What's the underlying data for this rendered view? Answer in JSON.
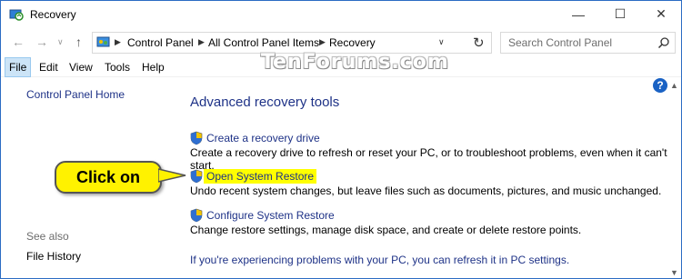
{
  "window": {
    "title": "Recovery",
    "controls": {
      "minimize": "—",
      "maximize": "☐",
      "close": "✕"
    }
  },
  "address_bar": {
    "breadcrumbs": [
      "Control Panel",
      "All Control Panel Items",
      "Recovery"
    ],
    "search_placeholder": "Search Control Panel"
  },
  "menu": {
    "file": "File",
    "edit": "Edit",
    "view": "View",
    "tools": "Tools",
    "help": "Help"
  },
  "watermark": "TenForums.com",
  "sidebar": {
    "home": "Control Panel Home",
    "see_also_heading": "See also",
    "see_also_items": [
      "File History"
    ]
  },
  "main": {
    "heading": "Advanced recovery tools",
    "tasks": [
      {
        "link": "Create a recovery drive",
        "description": "Create a recovery drive to refresh or reset your PC, or to troubleshoot problems, even when it can't start."
      },
      {
        "link": "Open System Restore",
        "description": "Undo recent system changes, but leave files such as documents, pictures, and music unchanged.",
        "highlighted": true
      },
      {
        "link": "Configure System Restore",
        "description": "Change restore settings, manage disk space, and create or delete restore points."
      }
    ],
    "bottom_link": "If you're experiencing problems with your PC, you can refresh it in PC settings."
  },
  "callout": {
    "text": "Click on"
  },
  "colors": {
    "link": "#1e3287",
    "highlight": "#ffff00",
    "callout": "#fff200",
    "window_border": "#2b6cc4"
  },
  "icons": [
    "recovery-app-icon",
    "back-arrow-icon",
    "forward-arrow-icon",
    "up-arrow-icon",
    "control-panel-icon",
    "refresh-icon",
    "search-icon",
    "help-icon",
    "uac-shield-icon"
  ]
}
